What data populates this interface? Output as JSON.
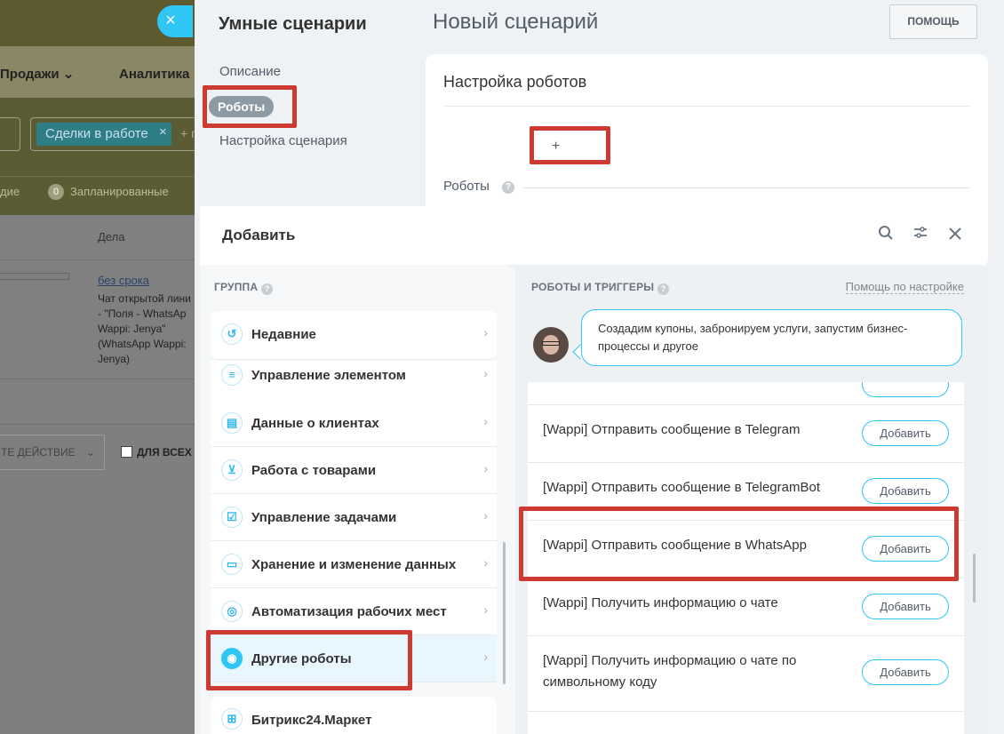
{
  "background": {
    "nav": [
      "Продажи",
      "Аналитика"
    ],
    "filter_chip": "Сделки в работе",
    "stats": [
      "дие",
      "0",
      "Запланированные"
    ],
    "column_header": "Дела",
    "due_link": "без срока",
    "activity_text": "Чат открытой лини - \"Поля - WhatsAp Wappi: Jenya\" (WhatsApp Wappi: Jenya)",
    "action_select": "ТЕ ДЕЙСТВИЕ",
    "for_all": "ДЛЯ ВСЕХ",
    "close_icon": "×"
  },
  "slider": {
    "title": "Умные сценарии",
    "subtitle": "Новый сценарий",
    "help_button": "ПОМОЩЬ",
    "nav": [
      "Описание",
      "Роботы",
      "Настройка сценария"
    ],
    "active_nav": "Роботы",
    "card_title": "Настройка роботов",
    "add_symbol": "+",
    "robots_label": "Роботы",
    "help_icon": "?"
  },
  "dialog": {
    "title": "Добавить",
    "icons": [
      "search-icon",
      "filter-icon",
      "close-icon"
    ],
    "group_header": "ГРУППА",
    "robots_header": "РОБОТЫ И ТРИГГЕРЫ",
    "help_link": "Помощь по настройке",
    "bubble_text": "Создадим купоны, забронируем услуги, запустим бизнес-процессы и другое",
    "groups": [
      {
        "label": "Недавние",
        "icon": "history-icon",
        "glyph": "↺"
      },
      {
        "label": "Управление элементом",
        "icon": "element-icon",
        "glyph": "≡"
      },
      {
        "label": "Данные о клиентах",
        "icon": "client-card-icon",
        "glyph": "▤"
      },
      {
        "label": "Работа с товарами",
        "icon": "cart-icon",
        "glyph": "⊻"
      },
      {
        "label": "Управление задачами",
        "icon": "task-icon",
        "glyph": "☑"
      },
      {
        "label": "Хранение и изменение данных",
        "icon": "storage-icon",
        "glyph": "▭"
      },
      {
        "label": "Автоматизация рабочих мест",
        "icon": "automation-icon",
        "glyph": "◎"
      },
      {
        "label": "Другие роботы",
        "icon": "robot-icon",
        "glyph": "◉"
      },
      {
        "label": "Битрикс24.Маркет",
        "icon": "market-icon",
        "glyph": "⊞"
      }
    ],
    "selected_group": "Другие роботы",
    "chevron": "›",
    "add_label": "Добавить",
    "robots": [
      "[Wappi] Отправить сообщение в Telegram",
      "[Wappi] Отправить сообщение в TelegramBot",
      "[Wappi] Отправить сообщение в WhatsApp",
      "[Wappi] Получить информацию о чате",
      "[Wappi] Получить информацию о чате по символьному коду"
    ]
  }
}
